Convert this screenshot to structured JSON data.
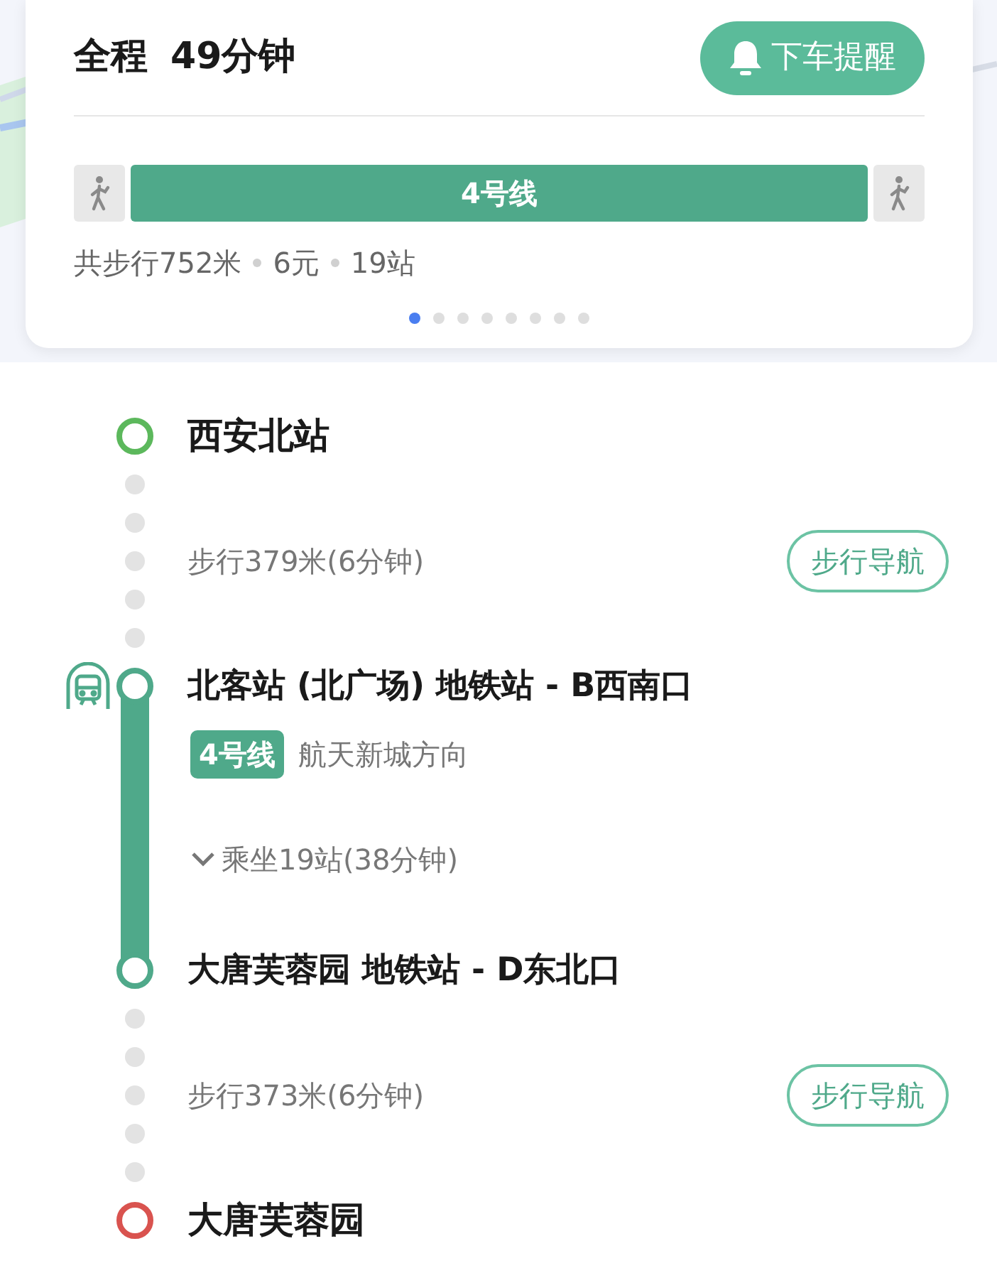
{
  "summary": {
    "label": "全程",
    "duration": "49分钟",
    "reminder_button": "下车提醒",
    "segments": [
      {
        "kind": "walk"
      },
      {
        "kind": "subway",
        "label": "4号线"
      },
      {
        "kind": "walk"
      }
    ],
    "stats": [
      "共步行752米",
      "6元",
      "19站"
    ],
    "pager": [
      {
        "selected": true
      },
      {
        "selected": false
      },
      {
        "selected": false
      },
      {
        "selected": false
      },
      {
        "selected": false
      },
      {
        "selected": false
      },
      {
        "selected": false
      },
      {
        "selected": false
      }
    ]
  },
  "steps": [
    {
      "kind": "station",
      "name": "西安北站",
      "color": "#5cb85c"
    },
    {
      "kind": "walk",
      "text": "步行379米(6分钟)",
      "button": "步行导航"
    },
    {
      "kind": "board",
      "name": "北客站 (北广场) 地铁站 - B西南口",
      "color": "#4fa98a"
    },
    {
      "kind": "line",
      "badge": "4号线",
      "direction": "航天新城方向"
    },
    {
      "kind": "ride",
      "text": "乘坐19站(38分钟)",
      "expanded": false
    },
    {
      "kind": "alight",
      "name": "大唐芙蓉园 地铁站 - D东北口",
      "color": "#4fa98a"
    },
    {
      "kind": "walk",
      "text": "步行373米(6分钟)",
      "button": "步行导航"
    },
    {
      "kind": "station",
      "name": "大唐芙蓉园",
      "color": "#d9534f"
    }
  ]
}
